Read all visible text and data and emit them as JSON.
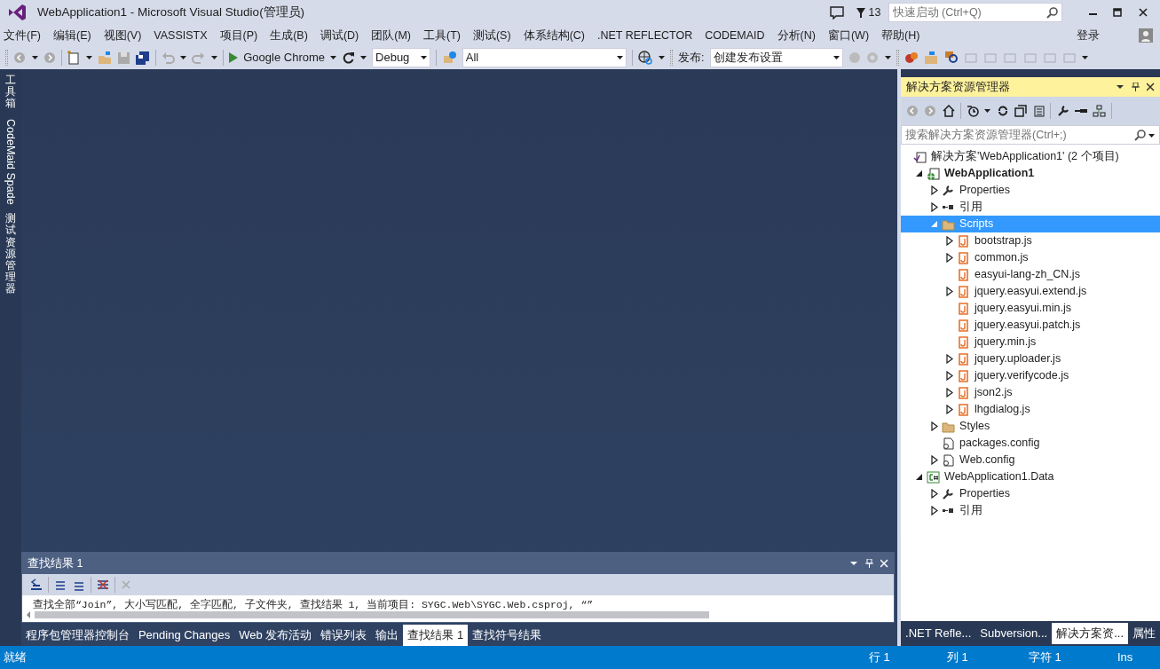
{
  "window": {
    "title": "WebApplication1 - Microsoft Visual Studio(管理员)",
    "notification_count": "13",
    "quick_launch": {
      "placeholder": "快速启动 (Ctrl+Q)"
    }
  },
  "menu": [
    "文件(F)",
    "编辑(E)",
    "视图(V)",
    "VASSISTX",
    "项目(P)",
    "生成(B)",
    "调试(D)",
    "团队(M)",
    "工具(T)",
    "测试(S)",
    "体系结构(C)",
    ".NET REFLECTOR",
    "CODEMAID",
    "分析(N)",
    "窗口(W)",
    "帮助(H)"
  ],
  "sign_in": "登录",
  "toolbar": {
    "run_target": "Google Chrome",
    "configuration": "Debug",
    "platform": "All",
    "publish_label": "发布:",
    "publish_profile": "创建发布设置"
  },
  "left_tabs": [
    {
      "label": "工具箱",
      "kind": "cjk"
    },
    {
      "label": "CodeMaid Spade",
      "kind": "latin"
    },
    {
      "label": "测试资源管理器",
      "kind": "cjk"
    }
  ],
  "solution_explorer": {
    "title": "解决方案资源管理器",
    "search": {
      "placeholder": "搜索解决方案资源管理器(Ctrl+;)"
    },
    "tree": [
      {
        "label": "解决方案'WebApplication1' (2 个项目)",
        "kind": "solution",
        "selected": false,
        "children": [
          {
            "label": "WebApplication1",
            "kind": "webproject",
            "startup": true,
            "expanded": true,
            "selected": false,
            "children": [
              {
                "label": "Properties",
                "kind": "wrench",
                "expanded": false,
                "selected": false
              },
              {
                "label": "引用",
                "kind": "references",
                "expanded": false,
                "selected": false
              },
              {
                "label": "Scripts",
                "kind": "folder",
                "expanded": true,
                "selected": true,
                "children": [
                  {
                    "label": "bootstrap.js",
                    "kind": "script",
                    "expanded": false,
                    "selected": false
                  },
                  {
                    "label": "common.js",
                    "kind": "script",
                    "expanded": false,
                    "selected": false
                  },
                  {
                    "label": "easyui-lang-zh_CN.js",
                    "kind": "script",
                    "selected": false
                  },
                  {
                    "label": "jquery.easyui.extend.js",
                    "kind": "script",
                    "expanded": false,
                    "selected": false
                  },
                  {
                    "label": "jquery.easyui.min.js",
                    "kind": "script",
                    "selected": false
                  },
                  {
                    "label": "jquery.easyui.patch.js",
                    "kind": "script",
                    "selected": false
                  },
                  {
                    "label": "jquery.min.js",
                    "kind": "script",
                    "selected": false
                  },
                  {
                    "label": "jquery.uploader.js",
                    "kind": "script",
                    "expanded": false,
                    "selected": false
                  },
                  {
                    "label": "jquery.verifycode.js",
                    "kind": "script",
                    "expanded": false,
                    "selected": false
                  },
                  {
                    "label": "json2.js",
                    "kind": "script",
                    "expanded": false,
                    "selected": false
                  },
                  {
                    "label": "lhgdialog.js",
                    "kind": "script",
                    "expanded": false,
                    "selected": false
                  }
                ]
              },
              {
                "label": "Styles",
                "kind": "folder",
                "expanded": false,
                "selected": false
              },
              {
                "label": "packages.config",
                "kind": "config",
                "selected": false
              },
              {
                "label": "Web.config",
                "kind": "config",
                "expanded": false,
                "selected": false
              }
            ]
          },
          {
            "label": "WebApplication1.Data",
            "kind": "csproject",
            "startup": false,
            "expanded": true,
            "selected": false,
            "children": [
              {
                "label": "Properties",
                "kind": "wrench",
                "expanded": false,
                "selected": false
              },
              {
                "label": "引用",
                "kind": "references",
                "expanded": false,
                "selected": false
              }
            ]
          }
        ]
      }
    ]
  },
  "right_tabs": [
    {
      "label": ".NET Refle...",
      "selected": false
    },
    {
      "label": "Subversion...",
      "selected": false
    },
    {
      "label": "解决方案资...",
      "selected": true
    },
    {
      "label": "属性",
      "selected": false
    }
  ],
  "find_results": {
    "title": "查找结果 1",
    "line": "查找全部“Join”, 大小写匹配, 全字匹配, 子文件夹, 查找结果 1, 当前项目: SYGC.Web\\SYGC.Web.csproj, “”"
  },
  "bottom_tabs": [
    {
      "label": "程序包管理器控制台",
      "selected": false
    },
    {
      "label": "Pending Changes",
      "selected": false
    },
    {
      "label": "Web 发布活动",
      "selected": false
    },
    {
      "label": "错误列表",
      "selected": false
    },
    {
      "label": "输出",
      "selected": false
    },
    {
      "label": "查找结果 1",
      "selected": true
    },
    {
      "label": "查找符号结果",
      "selected": false
    }
  ],
  "status_bar": {
    "state": "就绪",
    "line": "行 1",
    "column": "列 1",
    "char": "字符 1",
    "mode": "Ins"
  }
}
